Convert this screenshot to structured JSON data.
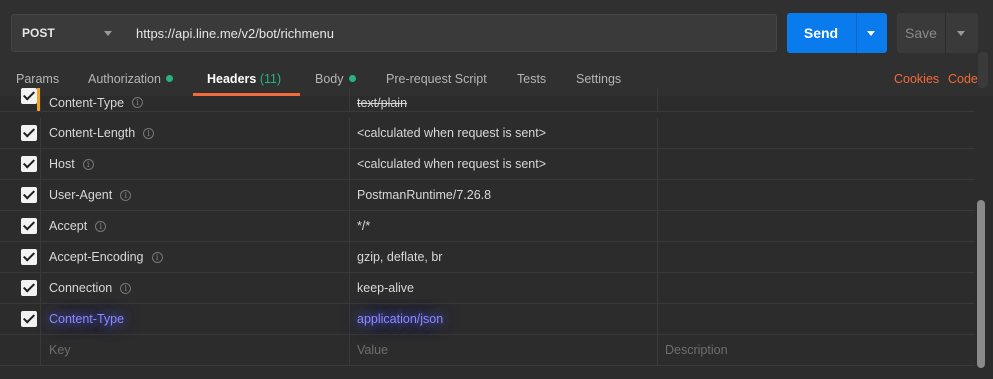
{
  "request": {
    "method": "POST",
    "url": "https://api.line.me/v2/bot/richmenu",
    "send_label": "Send",
    "save_label": "Save"
  },
  "tabs": [
    {
      "label": "Params"
    },
    {
      "label": "Authorization"
    },
    {
      "label": "Headers",
      "count": "(11)"
    },
    {
      "label": "Body"
    },
    {
      "label": "Pre-request Script"
    },
    {
      "label": "Tests"
    },
    {
      "label": "Settings"
    }
  ],
  "links": {
    "cookies": "Cookies",
    "code": "Code"
  },
  "headers": [
    {
      "key": "Content-Type",
      "value": "text/plain"
    },
    {
      "key": "Content-Length",
      "value": "<calculated when request is sent>"
    },
    {
      "key": "Host",
      "value": "<calculated when request is sent>"
    },
    {
      "key": "User-Agent",
      "value": "PostmanRuntime/7.26.8"
    },
    {
      "key": "Accept",
      "value": "*/*"
    },
    {
      "key": "Accept-Encoding",
      "value": "gzip, deflate, br"
    },
    {
      "key": "Connection",
      "value": "keep-alive"
    },
    {
      "key": "Content-Type",
      "value": "application/json"
    }
  ],
  "new_row": {
    "key": "Key",
    "value": "Value",
    "description": "Description"
  },
  "colors": {
    "send": "#097bed",
    "accent": "#f26b3a",
    "status_dot": "#26b47f"
  }
}
